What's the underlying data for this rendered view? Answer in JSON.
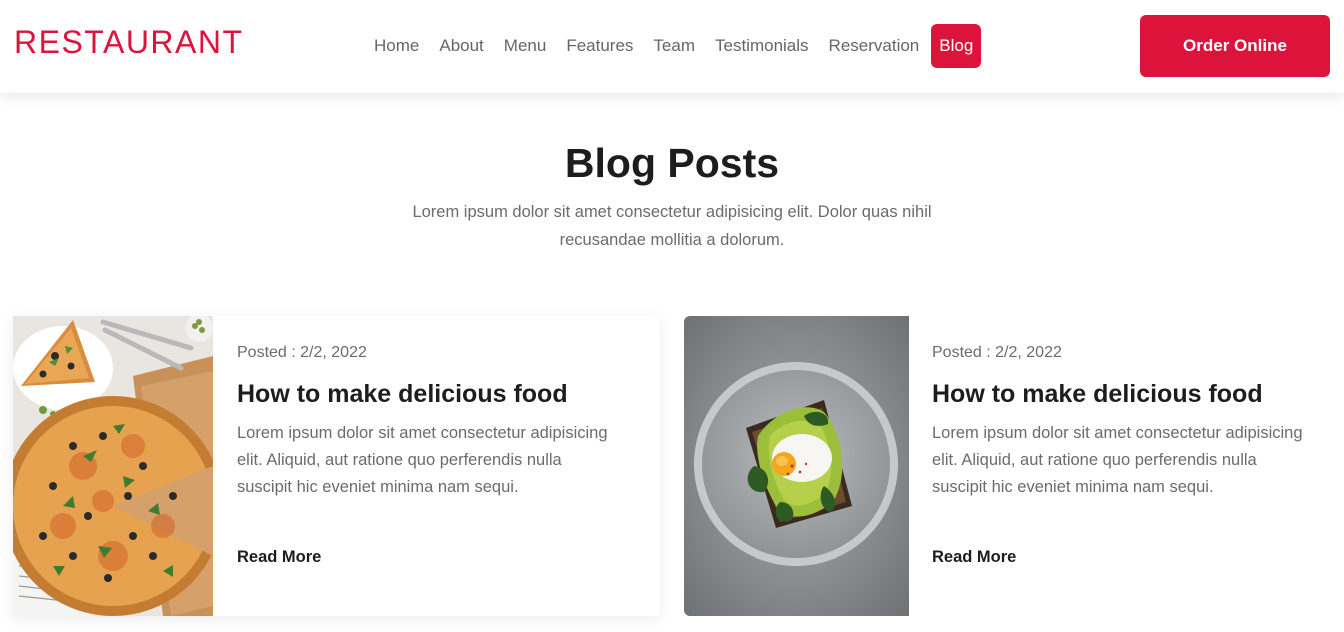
{
  "header": {
    "logo": "RESTAURANT",
    "nav": [
      {
        "label": "Home"
      },
      {
        "label": "About"
      },
      {
        "label": "Menu"
      },
      {
        "label": "Features"
      },
      {
        "label": "Team"
      },
      {
        "label": "Testimonials"
      },
      {
        "label": "Reservation"
      },
      {
        "label": "Blog",
        "active": true
      }
    ],
    "order_button": "Order Online"
  },
  "section": {
    "title": "Blog Posts",
    "subtitle": "Lorem ipsum dolor sit amet consectetur adipisicing elit. Dolor quas nihil recusandae mollitia a dolorum."
  },
  "posts": [
    {
      "image": "pizza-photo",
      "date": "Posted : 2/2, 2022",
      "title": "How to make delicious food",
      "excerpt": "Lorem ipsum dolor sit amet consectetur adipisicing elit. Aliquid, aut ratione quo perferendis nulla suscipit hic eveniet minima nam sequi.",
      "read_more": "Read More"
    },
    {
      "image": "avocado-toast-photo",
      "date": "Posted : 2/2, 2022",
      "title": "How to make delicious food",
      "excerpt": "Lorem ipsum dolor sit amet consectetur adipisicing elit. Aliquid, aut ratione quo perferendis nulla suscipit hic eveniet minima nam sequi.",
      "read_more": "Read More"
    }
  ],
  "colors": {
    "accent": "#dc143c",
    "heading": "#1d1d1d",
    "body_text": "#6b6b6b"
  }
}
